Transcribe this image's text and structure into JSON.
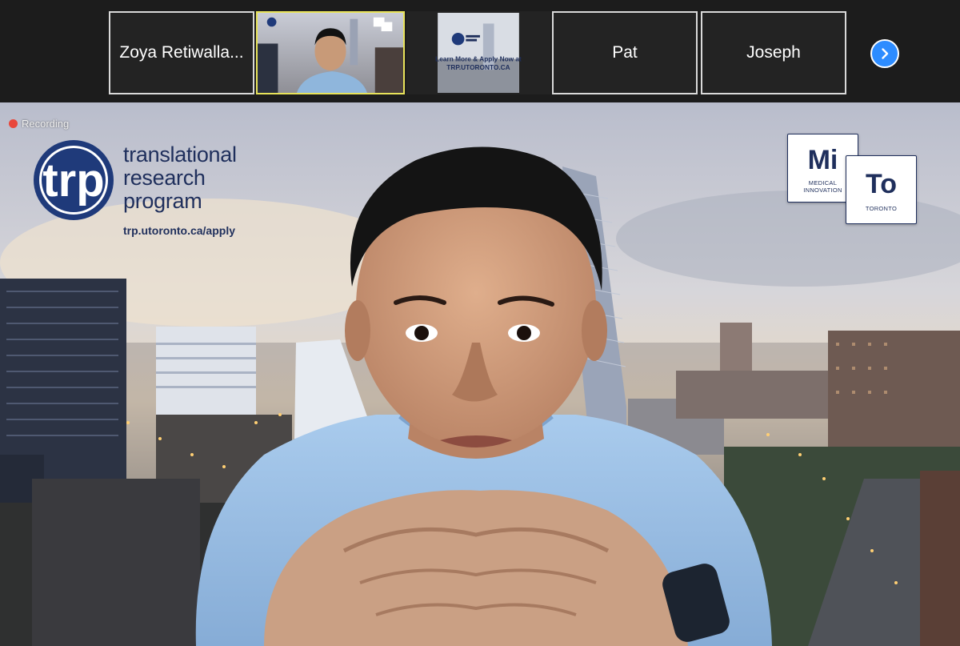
{
  "participants": [
    {
      "name": "Zoya Retiwalla..."
    },
    {
      "name": ""
    },
    {
      "name": ""
    },
    {
      "name": "Pat"
    },
    {
      "name": "Joseph"
    }
  ],
  "recording": {
    "label": "Recording",
    "color": "#e8473b"
  },
  "background": {
    "trp": {
      "line1": "translational",
      "line2": "research",
      "line3": "program",
      "url": "trp.utoronto.ca/apply"
    },
    "mito": {
      "mi": "Mi",
      "to": "To",
      "mi_sub1": "MEDICAL",
      "mi_sub2": "INNOVATION",
      "to_sub": "TORONTO"
    }
  },
  "shared_tile": {
    "line1": "Learn More & Apply Now at",
    "line2": "TRP.UTORONTO.CA"
  },
  "colors": {
    "accent": "#2d8cff",
    "active_border": "#e8e35a",
    "brand_navy": "#1f2f5c"
  },
  "icons": {
    "next": "chevron-right-icon"
  }
}
